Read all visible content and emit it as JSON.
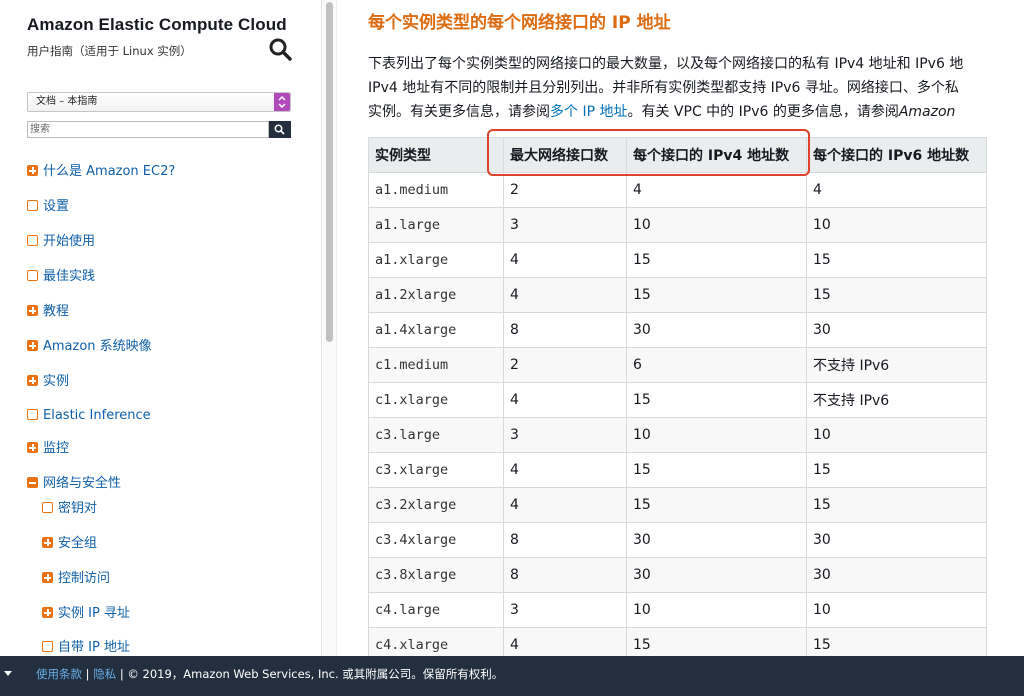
{
  "sidebar": {
    "title": "Amazon Elastic Compute Cloud",
    "subtitle": "用户指南（适用于 Linux 实例）",
    "doc_select": "文档 – 本指南",
    "search_placeholder": "搜索",
    "items": [
      {
        "label": "什么是 Amazon EC2?",
        "icon": "plus"
      },
      {
        "label": "设置",
        "icon": "empty"
      },
      {
        "label": "开始使用",
        "icon": "empty"
      },
      {
        "label": "最佳实践",
        "icon": "empty"
      },
      {
        "label": "教程",
        "icon": "plus"
      },
      {
        "label": "Amazon 系统映像",
        "icon": "plus"
      },
      {
        "label": "实例",
        "icon": "plus"
      },
      {
        "label": "Elastic Inference",
        "icon": "empty"
      },
      {
        "label": "监控",
        "icon": "plus"
      },
      {
        "label": "网络与安全性",
        "icon": "minus"
      },
      {
        "label": "密钥对",
        "icon": "empty"
      },
      {
        "label": "安全组",
        "icon": "plus"
      },
      {
        "label": "控制访问",
        "icon": "plus"
      },
      {
        "label": "实例 IP 寻址",
        "icon": "plus"
      },
      {
        "label": "自带 IP 地址",
        "icon": "empty"
      }
    ]
  },
  "main": {
    "heading": "每个实例类型的每个网络接口的 IP 地址",
    "para1": "下表列出了每个实例类型的网络接口的最大数量，以及每个网络接口的私有 IPv4 地址和 IPv6 地",
    "para2": "IPv4 地址有不同的限制并且分别列出。并非所有实例类型都支持 IPv6 寻址。网络接口、多个私",
    "para3_a": "实例。有关更多信息，请参阅",
    "para3_link": "多个 IP 地址",
    "para3_b": "。有关 VPC 中的 IPv6 的更多信息，请参阅",
    "para3_italic": "Amazon",
    "table": {
      "headers": [
        "实例类型",
        "最大网络接口数",
        "每个接口的 IPv4 地址数",
        "每个接口的 IPv6 地址数"
      ],
      "rows": [
        [
          "a1.medium",
          "2",
          "4",
          "4"
        ],
        [
          "a1.large",
          "3",
          "10",
          "10"
        ],
        [
          "a1.xlarge",
          "4",
          "15",
          "15"
        ],
        [
          "a1.2xlarge",
          "4",
          "15",
          "15"
        ],
        [
          "a1.4xlarge",
          "8",
          "30",
          "30"
        ],
        [
          "c1.medium",
          "2",
          "6",
          "不支持 IPv6"
        ],
        [
          "c1.xlarge",
          "4",
          "15",
          "不支持 IPv6"
        ],
        [
          "c3.large",
          "3",
          "10",
          "10"
        ],
        [
          "c3.xlarge",
          "4",
          "15",
          "15"
        ],
        [
          "c3.2xlarge",
          "4",
          "15",
          "15"
        ],
        [
          "c3.4xlarge",
          "8",
          "30",
          "30"
        ],
        [
          "c3.8xlarge",
          "8",
          "30",
          "30"
        ],
        [
          "c4.large",
          "3",
          "10",
          "10"
        ],
        [
          "c4.xlarge",
          "4",
          "15",
          "15"
        ]
      ]
    }
  },
  "footer": {
    "terms": "使用条款",
    "sep1": " | ",
    "privacy": "隐私",
    "copyright": " | © 2019，Amazon Web Services, Inc. 或其附属公司。保留所有权利。"
  },
  "colors": {
    "heading": "#dd6b10",
    "link": "#0073bb",
    "nav_icon": "#ec7211",
    "footer_bg": "#232f3e",
    "highlight": "#e0412a"
  }
}
